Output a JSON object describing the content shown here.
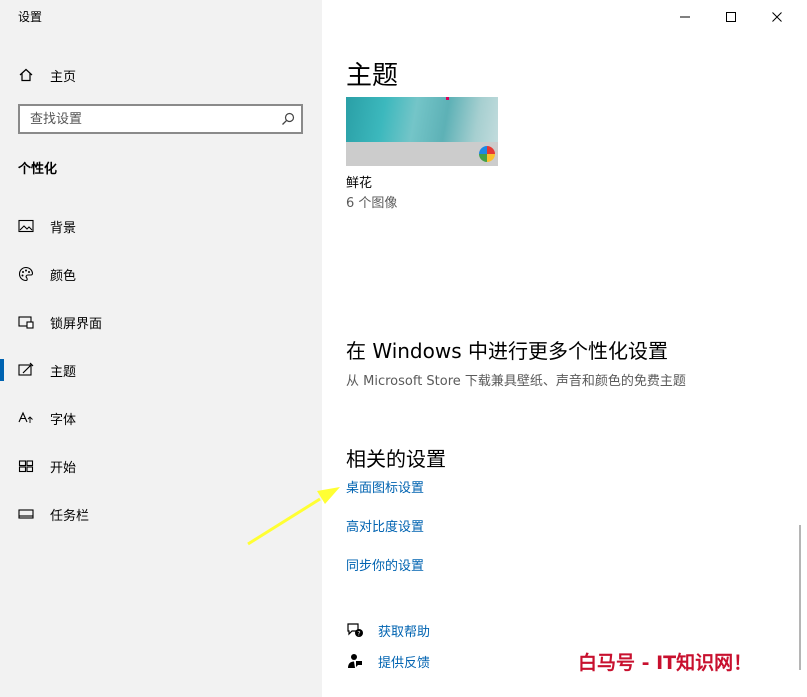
{
  "window": {
    "title": "设置",
    "controls": [
      "minimize-icon",
      "maximize-icon",
      "close-icon"
    ]
  },
  "sidebar": {
    "home_label": "主页",
    "search_placeholder": "查找设置",
    "section_label": "个性化",
    "items": [
      {
        "label": "背景",
        "icon": "picture-icon"
      },
      {
        "label": "颜色",
        "icon": "palette-icon"
      },
      {
        "label": "锁屏界面",
        "icon": "lock-screen-icon"
      },
      {
        "label": "主题",
        "icon": "theme-icon"
      },
      {
        "label": "字体",
        "icon": "font-icon"
      },
      {
        "label": "开始",
        "icon": "start-icon"
      },
      {
        "label": "任务栏",
        "icon": "taskbar-icon"
      }
    ],
    "active_item": "主题"
  },
  "main": {
    "heading": "主题",
    "current_theme": {
      "name": "鲜花",
      "count": "6 个图像"
    },
    "store_heading": "在 Windows 中进行更多个性化设置",
    "store_desc": "从 Microsoft Store 下载兼具壁纸、声音和颜色的免费主题",
    "related_heading": "相关的设置",
    "related_links": [
      "桌面图标设置",
      "高对比度设置",
      "同步你的设置"
    ],
    "help": [
      {
        "label": "获取帮助",
        "icon": "help-chat-icon"
      },
      {
        "label": "提供反馈",
        "icon": "feedback-icon"
      }
    ]
  },
  "watermark": {
    "text": "白马号 - IT知识网！",
    "color": "#c8102e"
  },
  "colors": {
    "sidebar_bg": "#f2f2f2",
    "accent": "#0063b1",
    "arrow": "#ffff33"
  }
}
